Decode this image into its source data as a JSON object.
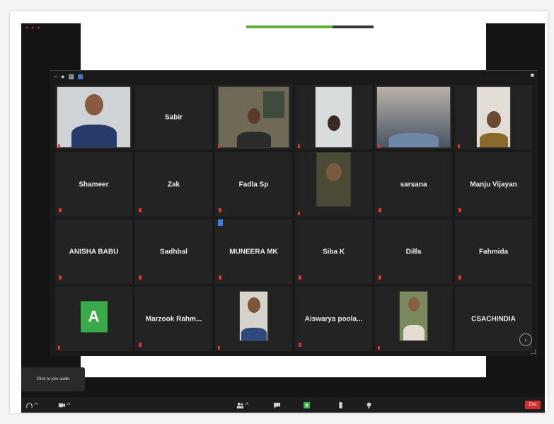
{
  "meeting": {
    "toast_text": "Click to join audio",
    "end_label": "End",
    "progress": 0.68,
    "colors": {
      "accent": "#5fb13a",
      "end": "#d32f2f",
      "muted": "#d9362c"
    }
  },
  "participants": [
    {
      "name": "",
      "caption": "",
      "type": "video"
    },
    {
      "name": "Sabir",
      "caption": "",
      "type": "name",
      "muted": false
    },
    {
      "name": "",
      "caption": "",
      "type": "video"
    },
    {
      "name": "",
      "caption": "",
      "type": "video"
    },
    {
      "name": "",
      "caption": "",
      "type": "video"
    },
    {
      "name": "",
      "caption": "",
      "type": "video"
    },
    {
      "name": "Shameer",
      "type": "name",
      "muted": true
    },
    {
      "name": "Zak",
      "type": "name",
      "muted": true
    },
    {
      "name": "Fadla Sp",
      "type": "name",
      "muted": true
    },
    {
      "name": "",
      "caption": "",
      "type": "video"
    },
    {
      "name": "sarsana",
      "type": "name",
      "muted": true
    },
    {
      "name": "Manju Vijayan",
      "type": "name",
      "muted": true
    },
    {
      "name": "ANISHA BABU",
      "type": "name",
      "muted": true
    },
    {
      "name": "Sadhbal",
      "type": "name",
      "muted": true
    },
    {
      "name": "MUNEERA MK",
      "type": "name",
      "muted": true
    },
    {
      "name": "Siba K",
      "type": "name",
      "muted": true
    },
    {
      "name": "Dilfa",
      "type": "name",
      "muted": true
    },
    {
      "name": "Fahmida",
      "type": "name",
      "muted": true
    },
    {
      "name": "",
      "caption": "",
      "type": "avatar",
      "letter": "A"
    },
    {
      "name": "Marzook Rahm...",
      "type": "name",
      "muted": true
    },
    {
      "name": "",
      "caption": "",
      "type": "video"
    },
    {
      "name": "Aiswarya poola...",
      "type": "name",
      "muted": true
    },
    {
      "name": "",
      "caption": "",
      "type": "video"
    },
    {
      "name": "CSACHINDIA",
      "type": "name",
      "muted": false
    }
  ]
}
